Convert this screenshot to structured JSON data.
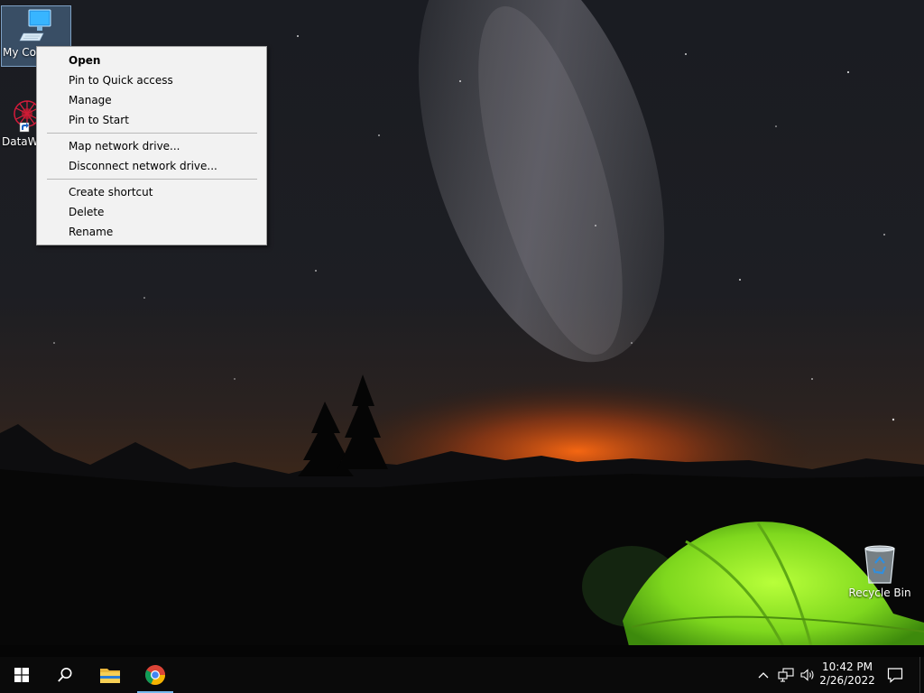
{
  "desktop": {
    "icons": [
      {
        "label": "My Computer"
      },
      {
        "label": "DataWa"
      },
      {
        "label": "Recycle Bin"
      }
    ]
  },
  "context_menu": {
    "items": [
      {
        "label": "Open",
        "bold": true
      },
      {
        "label": "Pin to Quick access"
      },
      {
        "label": "Manage"
      },
      {
        "label": "Pin to Start"
      },
      {
        "label": "Map network drive..."
      },
      {
        "label": "Disconnect network drive..."
      },
      {
        "label": "Create shortcut"
      },
      {
        "label": "Delete"
      },
      {
        "label": "Rename"
      }
    ]
  },
  "taskbar": {
    "icons": [
      "windows-start-icon",
      "search-icon",
      "file-explorer-icon",
      "chrome-icon"
    ],
    "tray_icons": [
      "chevron-up-icon",
      "network-icon",
      "volume-icon",
      "notification-icon"
    ],
    "clock": {
      "time": "10:42 PM",
      "date": "2/26/2022"
    },
    "accent_color": "#76b9ed"
  },
  "colors": {
    "menu_background": "#f2f2f2",
    "taskbar_background": "#0a0a0a",
    "tent_green": "#7fd81e"
  }
}
